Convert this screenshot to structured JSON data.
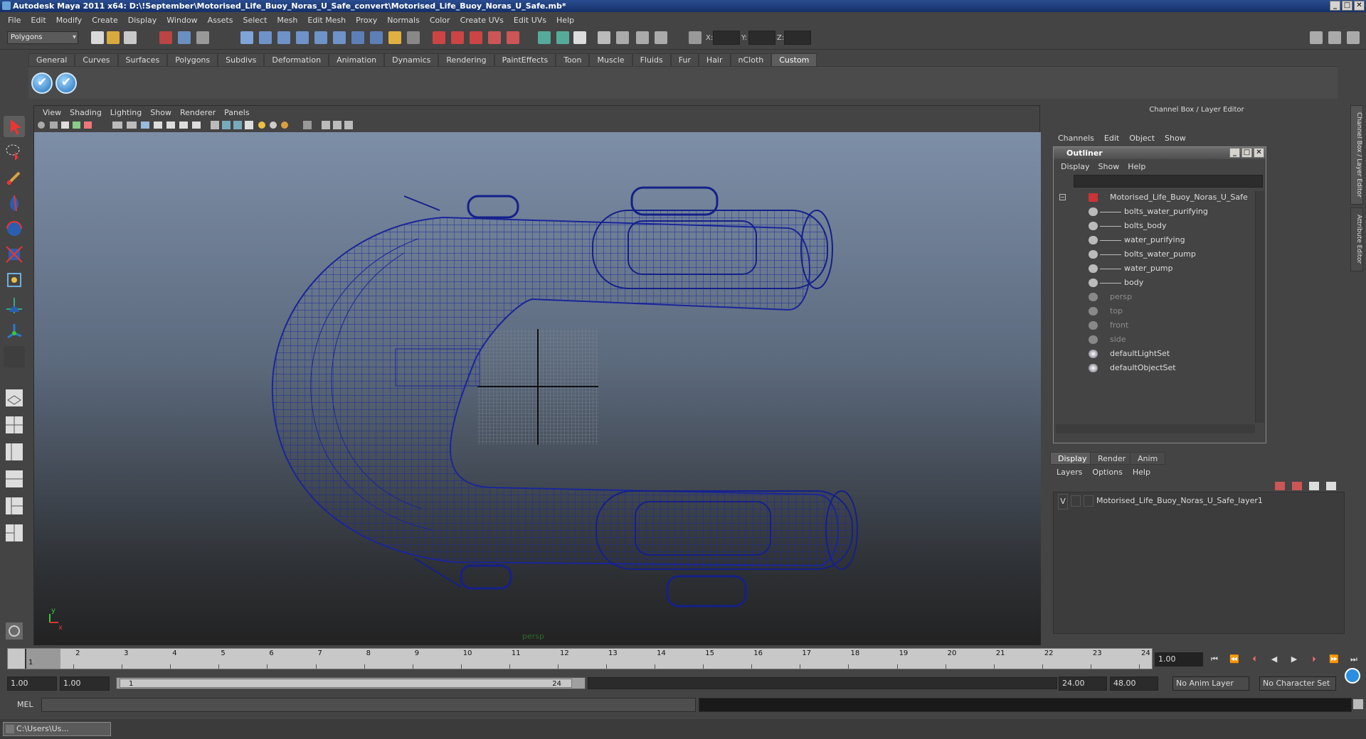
{
  "window": {
    "title": "Autodesk Maya 2011 x64: D:\\!September\\Motorised_Life_Buoy_Noras_U_Safe_convert\\Motorised_Life_Buoy_Noras_U_Safe.mb*"
  },
  "menubar": [
    "File",
    "Edit",
    "Modify",
    "Create",
    "Display",
    "Window",
    "Assets",
    "Select",
    "Mesh",
    "Edit Mesh",
    "Proxy",
    "Normals",
    "Color",
    "Create UVs",
    "Edit UVs",
    "Help"
  ],
  "statusline": {
    "mode": "Polygons",
    "x_label": "X:",
    "y_label": "Y:",
    "z_label": "Z:"
  },
  "shelf_tabs": [
    "General",
    "Curves",
    "Surfaces",
    "Polygons",
    "Subdivs",
    "Deformation",
    "Animation",
    "Dynamics",
    "Rendering",
    "PaintEffects",
    "Toon",
    "Muscle",
    "Fluids",
    "Fur",
    "Hair",
    "nCloth",
    "Custom"
  ],
  "shelf_active": "Custom",
  "viewport": {
    "menu": [
      "View",
      "Shading",
      "Lighting",
      "Show",
      "Renderer",
      "Panels"
    ],
    "camera_label": "persp",
    "axis": {
      "x": "x",
      "y": "y"
    }
  },
  "channel_box": {
    "title": "Channel Box / Layer Editor",
    "menu": [
      "Channels",
      "Edit",
      "Object",
      "Show"
    ],
    "side_tabs": [
      "Channel Box / Layer Editor",
      "Attribute Editor"
    ]
  },
  "outliner": {
    "title": "Outliner",
    "menu": [
      "Display",
      "Show",
      "Help"
    ],
    "items": [
      {
        "label": "Motorised_Life_Buoy_Noras_U_Safe",
        "kind": "root"
      },
      {
        "label": "bolts_water_purifying",
        "kind": "child"
      },
      {
        "label": "bolts_body",
        "kind": "child"
      },
      {
        "label": "water_purifying",
        "kind": "child"
      },
      {
        "label": "bolts_water_pump",
        "kind": "child"
      },
      {
        "label": "water_pump",
        "kind": "child"
      },
      {
        "label": "body",
        "kind": "child"
      },
      {
        "label": "persp",
        "kind": "dim"
      },
      {
        "label": "top",
        "kind": "dim"
      },
      {
        "label": "front",
        "kind": "dim"
      },
      {
        "label": "side",
        "kind": "dim"
      },
      {
        "label": "defaultLightSet",
        "kind": "set"
      },
      {
        "label": "defaultObjectSet",
        "kind": "set"
      }
    ]
  },
  "layer_editor": {
    "tabs": [
      "Display",
      "Render",
      "Anim"
    ],
    "menu": [
      "Layers",
      "Options",
      "Help"
    ],
    "layer_visible": "V",
    "layer_name": "Motorised_Life_Buoy_Noras_U_Safe_layer1"
  },
  "timeline": {
    "ticks": [
      1,
      2,
      3,
      4,
      5,
      6,
      7,
      8,
      9,
      10,
      11,
      12,
      13,
      14,
      15,
      16,
      17,
      18,
      19,
      20,
      21,
      22,
      23,
      24
    ],
    "current_frame": "1.00",
    "start_marker": "1"
  },
  "range": {
    "start": "1.00",
    "start_inner": "1.00",
    "slider_start": "1",
    "slider_end": "24",
    "end_inner": "24.00",
    "end": "48.00",
    "anim_layer": "No Anim Layer",
    "character_set": "No Character Set"
  },
  "command_line": {
    "label": "MEL"
  },
  "taskbar": {
    "item": "C:\\Users\\Us..."
  }
}
